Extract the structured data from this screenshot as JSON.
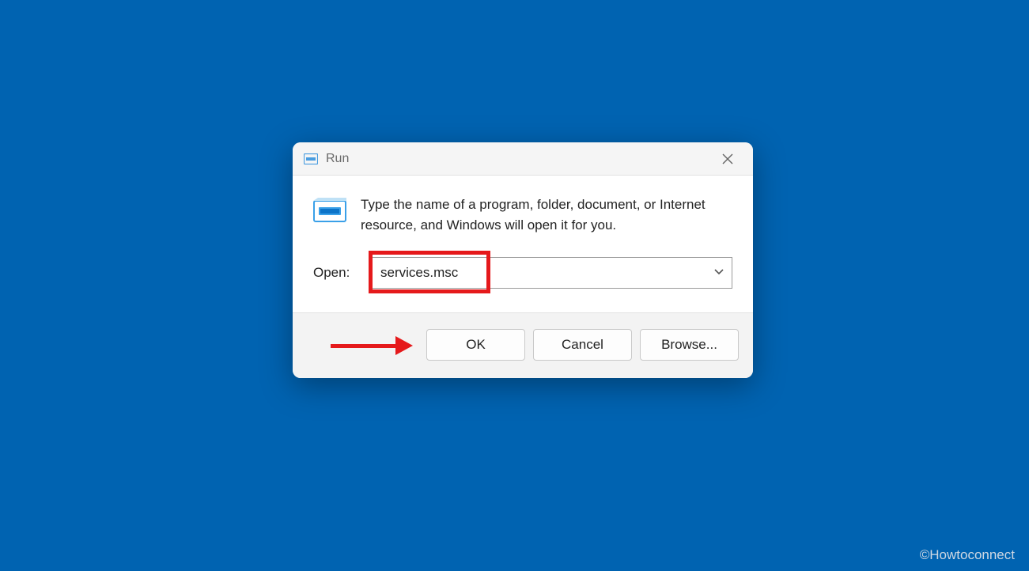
{
  "dialog": {
    "title": "Run",
    "description": "Type the name of a program, folder, document, or Internet resource, and Windows will open it for you.",
    "open_label": "Open:",
    "input_value": "services.msc",
    "buttons": {
      "ok": "OK",
      "cancel": "Cancel",
      "browse": "Browse..."
    }
  },
  "watermark": "©Howtoconnect"
}
